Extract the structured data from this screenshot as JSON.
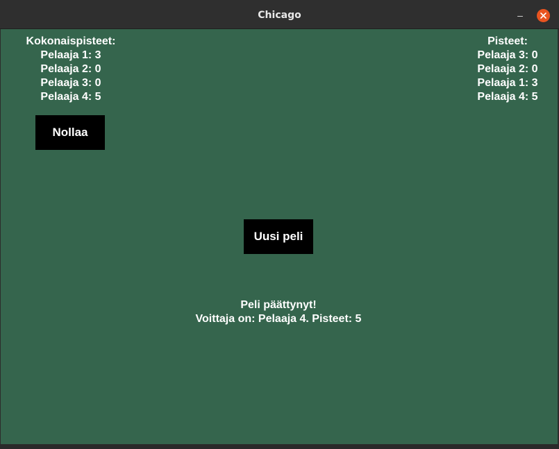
{
  "window": {
    "title": "Chicago",
    "minimize_symbol": "–"
  },
  "total_scores": {
    "heading": "Kokonaispisteet:",
    "rows": [
      "Pelaaja 1: 3",
      "Pelaaja 2: 0",
      "Pelaaja 3: 0",
      "Pelaaja 4: 5"
    ]
  },
  "round_scores": {
    "heading": "Pisteet:",
    "rows": [
      "Pelaaja 3: 0",
      "Pelaaja 2: 0",
      "Pelaaja 1: 3",
      "Pelaaja 4: 5"
    ]
  },
  "buttons": {
    "reset_label": "Nollaa",
    "new_game_label": "Uusi peli"
  },
  "result": {
    "line1": "Peli päättynyt!",
    "line2": "Voittaja on: Pelaaja 4. Pisteet: 5"
  },
  "colors": {
    "table_green": "#35654d",
    "close_orange": "#e95420"
  },
  "icons": {
    "close": "close-icon",
    "minimize": "minimize-icon"
  }
}
